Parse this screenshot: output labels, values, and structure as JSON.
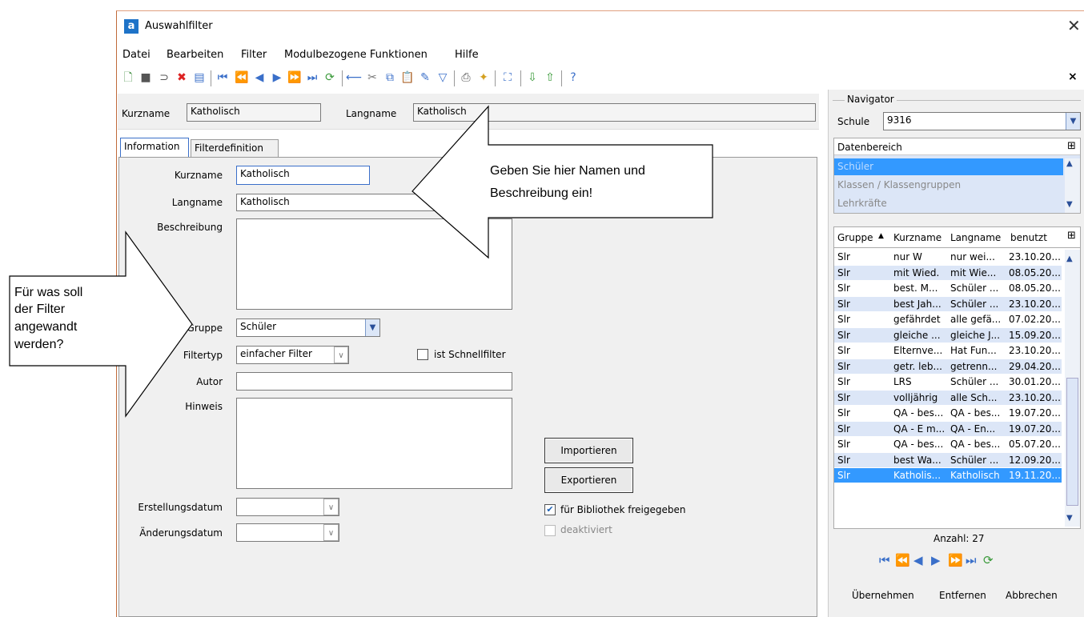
{
  "window": {
    "title": "Auswahlfilter",
    "app_icon": "a"
  },
  "menu": [
    "Datei",
    "Bearbeiten",
    "Filter",
    "Modulbezogene Funktionen",
    "Hilfe"
  ],
  "header": {
    "kurzname_label": "Kurzname",
    "kurzname_value": "Katholisch",
    "langname_label": "Langname",
    "langname_value": "Katholisch"
  },
  "tabs": [
    "Information",
    "Filterdefinition"
  ],
  "form": {
    "kurzname_label": "Kurzname",
    "kurzname_value": "Katholisch",
    "langname_label": "Langname",
    "langname_value": "Katholisch",
    "beschreibung_label": "Beschreibung",
    "beschreibung_value": "",
    "gruppe_label": "Gruppe",
    "gruppe_value": "Schüler",
    "filtertyp_label": "Filtertyp",
    "filtertyp_value": "einfacher Filter",
    "schnellfilter_label": "ist Schnellfilter",
    "autor_label": "Autor",
    "autor_value": "",
    "hinweis_label": "Hinweis",
    "hinweis_value": "",
    "erstellung_label": "Erstellungsdatum",
    "aenderung_label": "Änderungsdatum",
    "importieren": "Importieren",
    "exportieren": "Exportieren",
    "bibliothek_label": "für Bibliothek freigegeben",
    "bibliothek_checked": true,
    "deaktiviert_label": "deaktiviert"
  },
  "navigator": {
    "title": "Navigator",
    "schule_label": "Schule",
    "schule_value": "9316",
    "datenbereich_label": "Datenbereich",
    "datenbereich_items": [
      "Schüler",
      "Klassen / Klassengruppen",
      "Lehrkräfte"
    ],
    "columns": [
      "Gruppe",
      "Kurzname",
      "Langname",
      "benutzt"
    ],
    "rows": [
      [
        "Slr",
        "nur W",
        "nur wei...",
        "23.10.20..."
      ],
      [
        "Slr",
        "mit Wied.",
        "mit Wie...",
        "08.05.20..."
      ],
      [
        "Slr",
        "best. M...",
        "Schüler ...",
        "08.05.20..."
      ],
      [
        "Slr",
        "best Jah...",
        "Schüler ...",
        "23.10.20..."
      ],
      [
        "Slr",
        "gefährdet",
        "alle gefä...",
        "07.02.20..."
      ],
      [
        "Slr",
        "gleiche ...",
        "gleiche J...",
        "15.09.20..."
      ],
      [
        "Slr",
        "Elternve...",
        "Hat Fun...",
        "23.10.20..."
      ],
      [
        "Slr",
        "getr. leb...",
        "getrenn...",
        "29.04.20..."
      ],
      [
        "Slr",
        "LRS",
        "Schüler ...",
        "30.01.20..."
      ],
      [
        "Slr",
        "volljährig",
        "alle Sch...",
        "23.10.20..."
      ],
      [
        "Slr",
        "QA - bes...",
        "QA - bes...",
        "19.07.20..."
      ],
      [
        "Slr",
        "QA - E m...",
        "QA - En...",
        "19.07.20..."
      ],
      [
        "Slr",
        "QA - bes...",
        "QA - bes...",
        "05.07.20..."
      ],
      [
        "Slr",
        "best Wa...",
        "Schüler ...",
        "12.09.20..."
      ],
      [
        "Slr",
        "Katholis...",
        "Katholisch",
        "19.11.20..."
      ]
    ],
    "anzahl": "Anzahl: 27",
    "buttons": [
      "Übernehmen",
      "Entfernen",
      "Abbrechen"
    ]
  },
  "annotations": {
    "callout_top": [
      "Geben Sie hier Namen und",
      "Beschreibung ein!"
    ],
    "callout_left": [
      "Für was soll",
      "der Filter",
      "angewandt",
      "werden?"
    ]
  },
  "colors": {
    "selected": "#3399ff",
    "row_alt": "#dce6f7",
    "nav_icon": "#3a6fc9"
  }
}
